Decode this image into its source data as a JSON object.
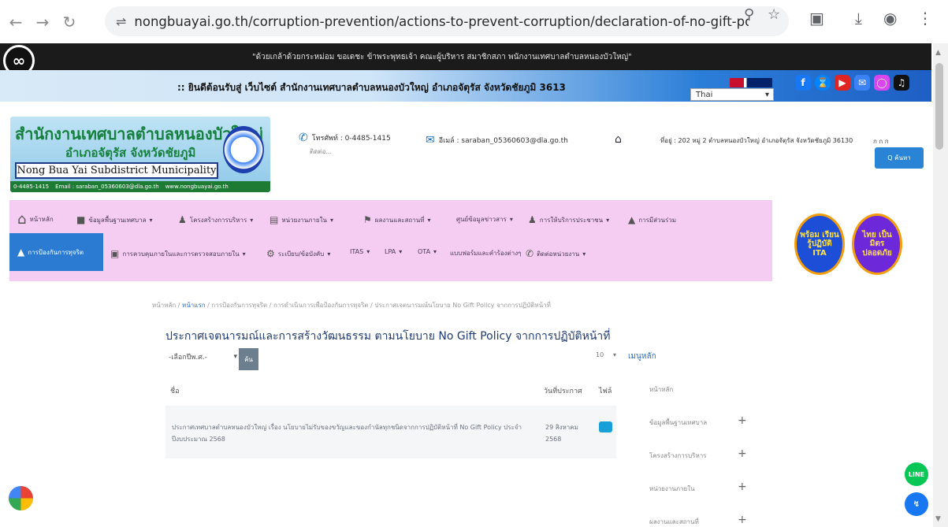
{
  "browser": {
    "url": "nongbuayai.go.th/corruption-prevention/actions-to-prevent-corruption/declaration-of-no-gift-policy-intentio...",
    "back_icon": "arrow-left-icon",
    "forward_icon": "arrow-right-icon",
    "reload_icon": "reload-icon"
  },
  "topbar": {
    "mourning_text": "\"ด้วยเกล้าด้วยกระหม่อม ขอเดชะ ข้าพระพุทธเจ้า คณะผู้บริหาร สมาชิกสภา พนักงานเทศบาลตำบลหนองบัวใหญ่\"",
    "marquee": ":: ยินดีต้อนรับสู่ เว็บไซต์ สำนักงานเทศบาลตำบลหนองบัวใหญ่ อำเภอจัตุรัส จังหวัดชัยภูมิ 3613",
    "language": "Thai"
  },
  "header": {
    "logo_th_line1": "สำนักงานเทศบาลตำบลหนองบัวใหญ่",
    "logo_th_line2": "อำเภอจัตุรัส จังหวัดชัยภูมิ",
    "logo_en": "Nong Bua Yai Subdistrict Municipality",
    "logo_phone": "0-4485-1415",
    "logo_email": "Email : saraban_05360603@dla.go.th",
    "logo_web": "www.nongbuayai.go.th",
    "phone_label": "โทรศัพท์ : 0-4485-1415",
    "phone_sub": "ติดต่อ...",
    "email_label": "อีเมล์ : saraban_05360603@dla.go.th",
    "address_label": "ที่อยู่ : 202 หมู่ 2 ตำบลหนองบัวใหญ่ อำเภอจัตุรัส จังหวัดชัยภูมิ 36130",
    "font_size_label": "ก ก ก",
    "search_label": "Q ค้นหา"
  },
  "menu": {
    "row1": [
      "หน้าหลัก",
      "ข้อมูลพื้นฐานเทศบาล",
      "โครงสร้างการบริหาร",
      "หน่วยงานภายใน",
      "ผลงานและสถานที่",
      "ศูนย์ข้อมูลข่าวสาร",
      "การให้บริการประชาชน",
      "การมีส่วนร่วม"
    ],
    "row2": [
      "การป้องกันการทุจริต",
      "การควบคุมภายในและการตรวจสอบภายใน",
      "ระเบียบ/ข้อบังคับ",
      "ITAS",
      "LPA",
      "OTA",
      "แบบฟอร์มและคำร้องต่างๆ",
      "ติดต่อหน่วยงาน"
    ],
    "badge_left": "พร้อม เรียนรู้ปฏิบัติ ITA",
    "badge_right": "ไทย เป็นมิตร ปลอดภัย"
  },
  "content": {
    "breadcrumb": [
      "หน้าหลัก",
      "หน้าแรก",
      "การป้องกันการทุจริต",
      "การดำเนินการเพื่อป้องกันการทุจริต",
      "ประกาศเจตนารมณ์นโยบาย No Gift Policy จากการปฏิบัติหน้าที่"
    ],
    "title": "ประกาศเจตนารมณ์และการสร้างวัฒนธรรม ตามนโยบาย No Gift Policy จากการปฏิบัติหน้าที่",
    "filter_placeholder": "-เลือกปีพ.ศ.-",
    "filter_button": "ค้น",
    "per_page": "10",
    "columns": {
      "name": "ชื่อ",
      "date": "วันที่ประกาศ",
      "file": "ไฟล์"
    },
    "row": {
      "name": "ประกาศเทศบาลตำบลหนองบัวใหญ่ เรื่อง นโยบายไม่รับของขวัญและของกำนัลทุกชนิดจากการปฏิบัติหน้าที่ No Gift Policy ประจำปีงบประมาณ 2568",
      "date_line1": "29 สิงหาคม",
      "date_line2": "2568"
    }
  },
  "sidebar": {
    "title": "เมนูหลัก",
    "items": [
      "หน้าหลัก",
      "ข้อมูลพื้นฐานเทศบาล",
      "โครงสร้างการบริหาร",
      "หน่วยงานภายใน",
      "ผลงานและสถานที่"
    ]
  },
  "floating": {
    "line_label": "LINE",
    "messenger_icon": "messenger-icon"
  }
}
